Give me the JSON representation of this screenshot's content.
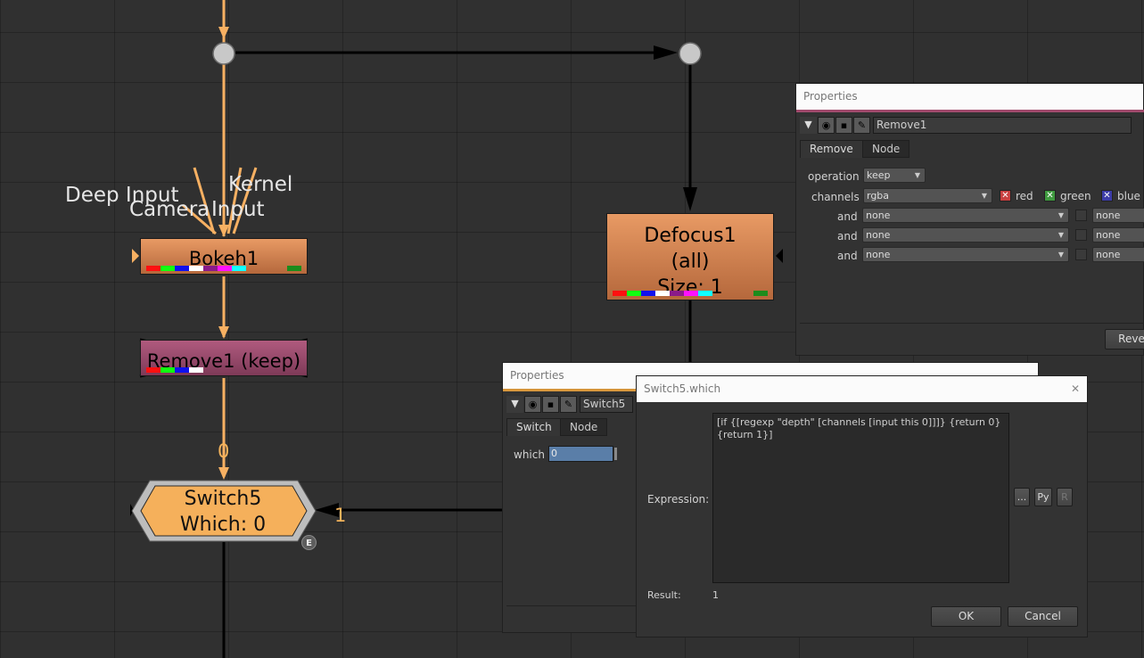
{
  "colors": {
    "background": "#303030",
    "wire_orange": "#f7b062",
    "wire_black": "#000000",
    "node_orange": "#d5865a",
    "node_remove": "#9b4a6c",
    "switch_fill": "#f5b05b"
  },
  "graph": {
    "input_labels": {
      "deep": "Deep Input",
      "camera": "Camera",
      "input": "Input",
      "kernel": "Kernel"
    },
    "nodes": {
      "bokeh": {
        "name": "Bokeh1"
      },
      "defocus": {
        "line1": "Defocus1",
        "line2": "(all)",
        "line3": "Size: 1"
      },
      "remove": {
        "name": "Remove1 (keep)",
        "disabled": true
      },
      "switch": {
        "line1": "Switch5",
        "line2": "Which: 0",
        "badge": "E"
      }
    },
    "pipe_labels": {
      "input0": "0",
      "input1": "1"
    }
  },
  "remove_panel": {
    "title": "Properties",
    "node_name": "Remove1",
    "tabs": [
      "Remove",
      "Node"
    ],
    "operation_label": "operation",
    "operation_value": "keep",
    "channels_label": "channels",
    "channels_value": "rgba",
    "checks": [
      "red",
      "green",
      "blue"
    ],
    "and_label": "and",
    "and_rows": [
      {
        "value": "none",
        "right": "none"
      },
      {
        "value": "none",
        "right": "none"
      },
      {
        "value": "none",
        "right": "none"
      }
    ],
    "revert_button": "Reve"
  },
  "switch_panel": {
    "title": "Properties",
    "node_name": "Switch5",
    "tabs": [
      "Switch",
      "Node"
    ],
    "which_label": "which",
    "which_value": "0"
  },
  "expr_dialog": {
    "title": "Switch5.which",
    "expression_label": "Expression:",
    "expression": "[if {[regexp \"depth\" [channels [input this 0]]]} {return 0} {return 1}]",
    "result_label": "Result:",
    "result_value": "1",
    "more_button": "...",
    "py_button": "Py",
    "r_button": "R",
    "ok_button": "OK",
    "cancel_button": "Cancel"
  }
}
